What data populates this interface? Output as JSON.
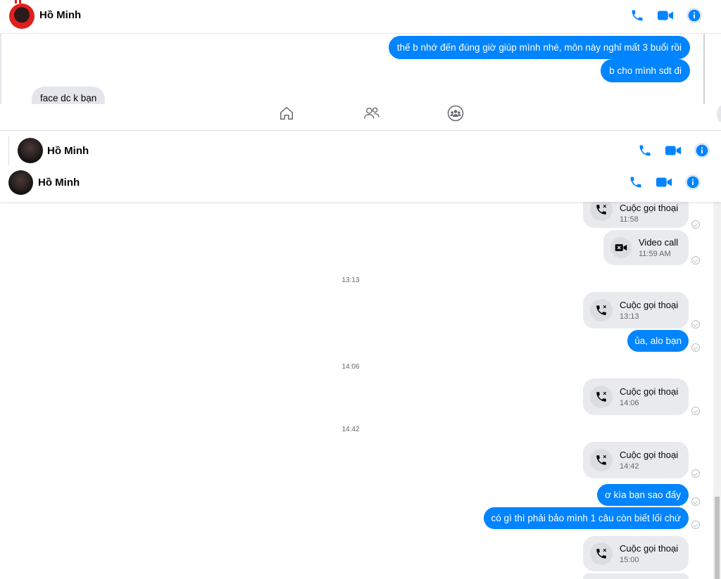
{
  "top_panel": {
    "contact_name": "Hồ Minh",
    "messages": [
      {
        "dir": "out",
        "text": "thế b nhớ đến đúng giờ giúp mình nhé, môn này nghỉ mất 3 buổi rồi"
      },
      {
        "dir": "out",
        "text": "b cho mình sdt đi"
      },
      {
        "dir": "in",
        "text": "face dc k bạn"
      }
    ]
  },
  "nav": {
    "items": [
      "home-icon",
      "friends-icon",
      "groups-icon"
    ]
  },
  "mid_panel": {
    "contact_name": "Hồ Minh"
  },
  "main_panel": {
    "contact_name": "Hồ Minh",
    "items": [
      {
        "type": "call",
        "title": "Cuộc gọi thoại",
        "time": "11:58"
      },
      {
        "type": "video",
        "title": "Video call",
        "time": "11:59 AM"
      },
      {
        "type": "stamp",
        "text": "13:13"
      },
      {
        "type": "call",
        "title": "Cuộc gọi thoại",
        "time": "13:13"
      },
      {
        "type": "msg",
        "text": "ủa, alo bạn"
      },
      {
        "type": "stamp",
        "text": "14:06"
      },
      {
        "type": "call",
        "title": "Cuộc gọi thoại",
        "time": "14:06"
      },
      {
        "type": "stamp",
        "text": "14:42"
      },
      {
        "type": "call",
        "title": "Cuộc gọi thoại",
        "time": "14:42"
      },
      {
        "type": "msg",
        "text": "ơ kìa bạn sao đấy"
      },
      {
        "type": "msg",
        "text": "có gì thì phải bảo mình 1 câu còn biết lối chứ"
      },
      {
        "type": "call",
        "title": "Cuộc gọi thoại",
        "time": "15:00"
      }
    ]
  },
  "colors": {
    "accent": "#0084ff",
    "bubble_in": "#e4e6eb",
    "call_bg": "#e9eaee"
  }
}
